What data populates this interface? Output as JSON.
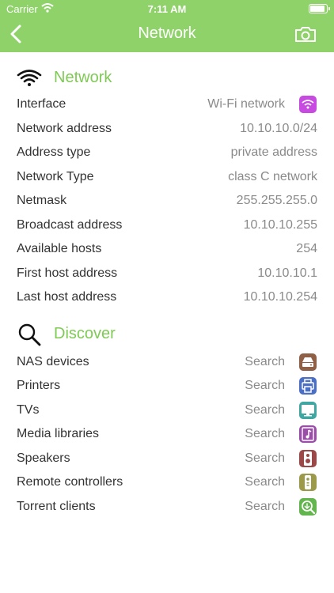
{
  "status": {
    "carrier": "Carrier",
    "time": "7:11 AM"
  },
  "nav": {
    "title": "Network"
  },
  "network": {
    "heading": "Network",
    "rows": [
      {
        "label": "Interface",
        "value": "Wi-Fi network",
        "icon": "wifi-icon",
        "color": "#c74be0"
      },
      {
        "label": "Network address",
        "value": "10.10.10.0/24"
      },
      {
        "label": "Address type",
        "value": "private address"
      },
      {
        "label": "Network Type",
        "value": "class C network"
      },
      {
        "label": "Netmask",
        "value": "255.255.255.0"
      },
      {
        "label": "Broadcast address",
        "value": "10.10.10.255"
      },
      {
        "label": "Available hosts",
        "value": "254"
      },
      {
        "label": "First host address",
        "value": "10.10.10.1"
      },
      {
        "label": "Last host address",
        "value": "10.10.10.254"
      }
    ]
  },
  "discover": {
    "heading": "Discover",
    "rows": [
      {
        "label": "NAS devices",
        "value": "Search",
        "icon": "nas-icon",
        "color": "#8f5f46"
      },
      {
        "label": "Printers",
        "value": "Search",
        "icon": "printer-icon",
        "color": "#4b6fc4"
      },
      {
        "label": "TVs",
        "value": "Search",
        "icon": "tv-icon",
        "color": "#3fa6a2"
      },
      {
        "label": "Media libraries",
        "value": "Search",
        "icon": "music-icon",
        "color": "#9a4ea8"
      },
      {
        "label": "Speakers",
        "value": "Search",
        "icon": "speaker-icon",
        "color": "#9b4848"
      },
      {
        "label": "Remote controllers",
        "value": "Search",
        "icon": "remote-icon",
        "color": "#9c9a48"
      },
      {
        "label": "Torrent clients",
        "value": "Search",
        "icon": "torrent-icon",
        "color": "#63b54d"
      }
    ]
  }
}
